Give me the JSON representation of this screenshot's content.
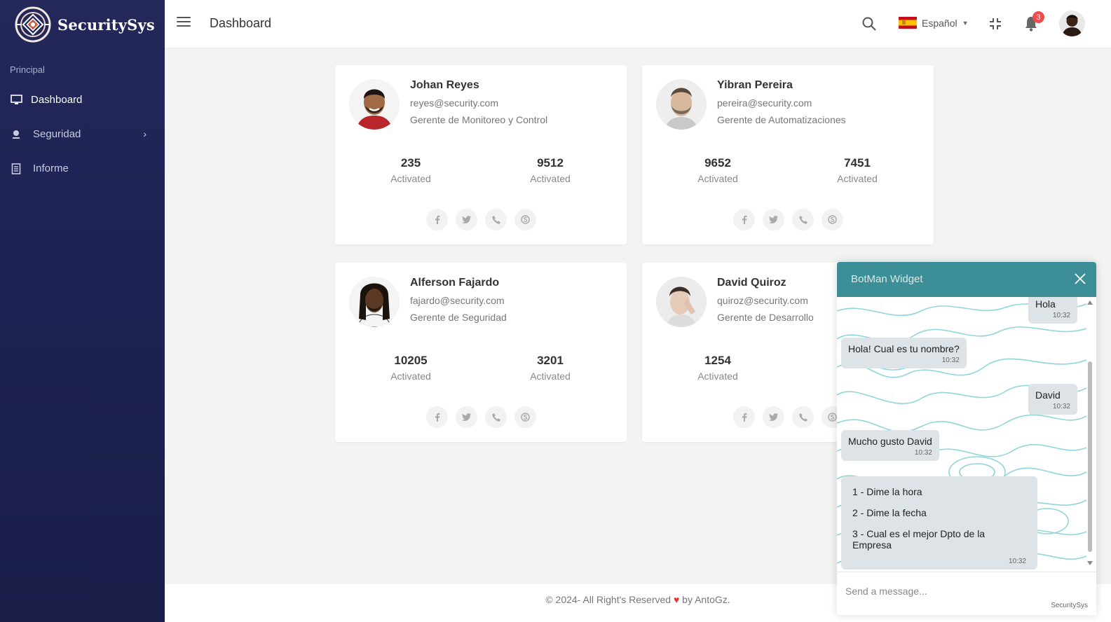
{
  "sidebar": {
    "brand": "SecuritySys",
    "section_title": "Principal",
    "items": [
      {
        "label": "Dashboard",
        "icon": "monitor-icon",
        "active": true
      },
      {
        "label": "Seguridad",
        "icon": "security-icon",
        "has_submenu": true
      },
      {
        "label": "Informe",
        "icon": "document-icon"
      }
    ]
  },
  "header": {
    "title": "Dashboard",
    "language": "Español",
    "notifications_count": "3"
  },
  "cards": [
    {
      "name": "Johan Reyes",
      "email": "reyes@security.com",
      "role": "Gerente de Monitoreo y Control",
      "stat1": "235",
      "stat1_label": "Activated",
      "stat2": "9512",
      "stat2_label": "Activated"
    },
    {
      "name": "Yibran Pereira",
      "email": "pereira@security.com",
      "role": "Gerente de Automatizaciones",
      "stat1": "9652",
      "stat1_label": "Activated",
      "stat2": "7451",
      "stat2_label": "Activated"
    },
    {
      "name": "Alferson Fajardo",
      "email": "fajardo@security.com",
      "role": "Gerente de Seguridad",
      "stat1": "10205",
      "stat1_label": "Activated",
      "stat2": "3201",
      "stat2_label": "Activated"
    },
    {
      "name": "David Quiroz",
      "email": "quiroz@security.com",
      "role": "Gerente de Desarrollo",
      "stat1": "1254",
      "stat1_label": "Activated"
    }
  ],
  "footer": {
    "prefix": "© 2024- All Right's Reserved",
    "suffix": "by AntoGz."
  },
  "chat": {
    "title": "BotMan Widget",
    "messages": [
      {
        "text": "Hola",
        "time": "10:32",
        "from": "user"
      },
      {
        "text": "Hola! Cual es tu nombre?",
        "time": "10:32",
        "from": "bot"
      },
      {
        "text": "David",
        "time": "10:32",
        "from": "user"
      },
      {
        "text": "Mucho gusto David",
        "time": "10:32",
        "from": "bot"
      }
    ],
    "options": [
      "1 - Dime la hora",
      "2 - Dime la fecha",
      "3 - Cual es el mejor Dpto de la Empresa"
    ],
    "options_time": "10:32",
    "input_placeholder": "Send a message...",
    "powered_by": "SecuritySys"
  },
  "colors": {
    "sidebar": "#23275a",
    "chat_header": "#3d8f97",
    "badge": "#f04e4e",
    "heart": "#e3342f"
  }
}
